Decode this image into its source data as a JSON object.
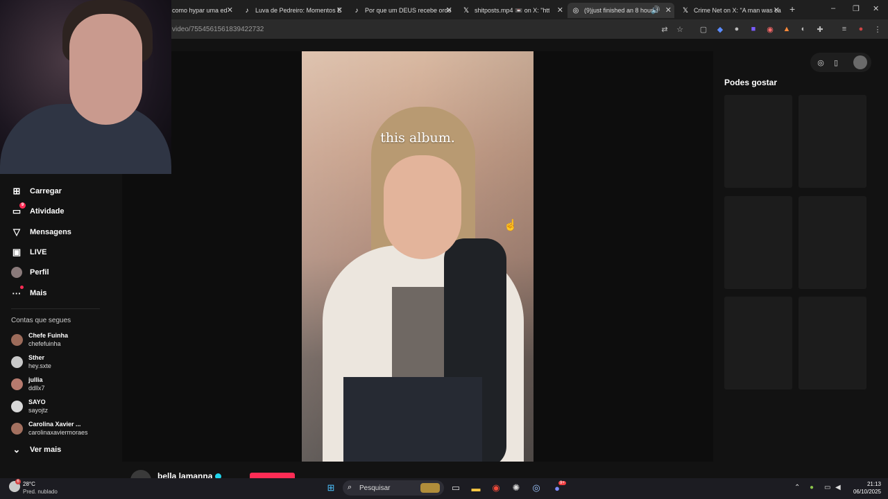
{
  "browser": {
    "tabs": [
      {
        "title": "como hypar uma ed",
        "favicon": "tiktok-icon"
      },
      {
        "title": "Luva de Pedreiro: Momentos E",
        "favicon": "tiktok-icon"
      },
      {
        "title": "Por que um DEUS recebe orde",
        "favicon": "tiktok-icon"
      },
      {
        "title": "shitposts.mp4 📼 on X: \"htt",
        "favicon": "x-icon"
      },
      {
        "title": "(9)just finished an 8 hour d",
        "favicon": "tiktok-icon"
      },
      {
        "title": "Crime Net on X: \"A man was ca",
        "favicon": "x-icon"
      }
    ],
    "active_tab": 4,
    "url": "video/7554561561839422732",
    "new_tab": "+",
    "window_controls": [
      "–",
      "❐",
      "✕"
    ]
  },
  "video": {
    "caption": "this album."
  },
  "sidebar": {
    "items": [
      {
        "label": "Carregar",
        "icon": "upload-icon",
        "badge": ""
      },
      {
        "label": "Atividade",
        "icon": "inbox-icon",
        "badge": "9"
      },
      {
        "label": "Mensagens",
        "icon": "send-icon",
        "badge": ""
      },
      {
        "label": "LIVE",
        "icon": "live-icon",
        "badge": ""
      },
      {
        "label": "Perfil",
        "icon": "avatar-icon",
        "badge": ""
      },
      {
        "label": "Mais",
        "icon": "more-icon",
        "badge": ""
      }
    ],
    "following_title": "Contas que segues",
    "following": [
      {
        "name": "Chefe Fuinha",
        "handle": "chefefuinha",
        "color": "#9c6b5a"
      },
      {
        "name": "Sther",
        "handle": "hey.sxte",
        "color": "#c9c9c9"
      },
      {
        "name": "jullia",
        "handle": "ddllx7",
        "color": "#b67a6e"
      },
      {
        "name": "SAYO",
        "handle": "sayojtz",
        "color": "#d8d8d8"
      },
      {
        "name": "Carolina Xavier ...",
        "handle": "carolinaxaviermoraes",
        "color": "#a3705f"
      }
    ],
    "see_more": "Ver mais"
  },
  "author": {
    "name": "bella lamanna"
  },
  "right_panel": {
    "title": "Podes gostar"
  },
  "taskbar": {
    "weather_temp": "28°C",
    "weather_cond": "Pred. nublado",
    "weather_badge": "6",
    "search_placeholder": "Pesquisar",
    "time": "21:13",
    "date": "06/10/2025",
    "discord_badge": "9+"
  },
  "colors": {
    "accent": "#fe2c55",
    "verified": "#20d5ec"
  }
}
